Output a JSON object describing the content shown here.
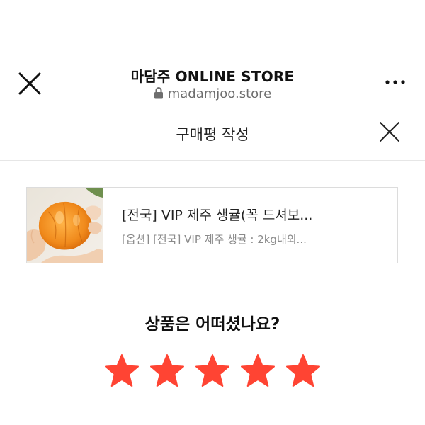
{
  "browser": {
    "site_title": "마담주 ONLINE STORE",
    "site_url": "madamjoo.store"
  },
  "review": {
    "header_title": "구매평 작성",
    "product": {
      "name": "[전국] VIP 제주 생귤(꼭 드셔보...",
      "option": "[옵션] [전국] VIP 제주 생귤 : 2kg내외..."
    },
    "question": "상품은 어떠셨나요?",
    "rating": 5,
    "rating_max": 5,
    "star_color": "#ff4433"
  },
  "icons": {
    "browser_close": "close-icon",
    "lock": "lock-icon",
    "more": "more-dots-icon",
    "review_close": "close-icon",
    "star": "star-icon"
  }
}
